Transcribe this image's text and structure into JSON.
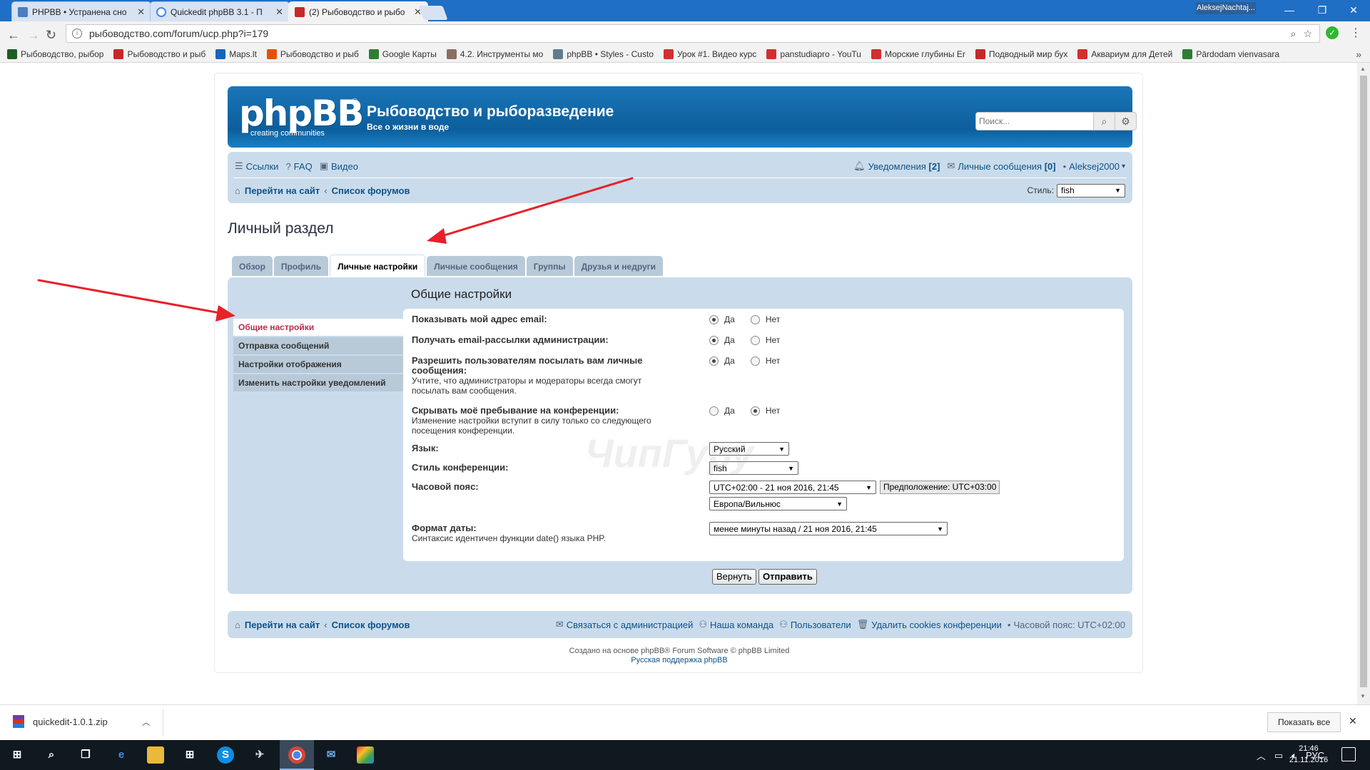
{
  "browser": {
    "tabs": [
      {
        "label": "PHPBB • Устранена сно",
        "favicon_color": "#4a7fc1"
      },
      {
        "label": "Quickedit phpBB 3.1 - П",
        "favicon_color": "#6a6a6a"
      },
      {
        "label": "(2) Рыбоводство и рыбо",
        "favicon_color": "#c62828"
      }
    ],
    "window_user": "AleksejNachtaj...",
    "url": "рыбоводство.com/forum/ucp.php?i=179",
    "bookmarks": [
      {
        "label": "Рыбоводство, рыбор",
        "color": "#1b5e20"
      },
      {
        "label": "Рыбоводство и рыб",
        "color": "#c62828"
      },
      {
        "label": "Maps.lt",
        "color": "#1565c0"
      },
      {
        "label": "Рыбоводство и рыб",
        "color": "#e65100"
      },
      {
        "label": "Google Карты",
        "color": "#2e7d32"
      },
      {
        "label": "4.2. Инструменты мо",
        "color": "#8d6e63"
      },
      {
        "label": "phpBB • Styles - Custo",
        "color": "#607d8b"
      },
      {
        "label": "Урок #1. Видео курс",
        "color": "#d32f2f"
      },
      {
        "label": "panstudiapro - YouTu",
        "color": "#d32f2f"
      },
      {
        "label": "Морские глубины Er",
        "color": "#d32f2f"
      },
      {
        "label": "Подводный мир бух",
        "color": "#c62828"
      },
      {
        "label": "Аквариум для Детей",
        "color": "#d32f2f"
      },
      {
        "label": "Pārdodam vienvasara",
        "color": "#2e7d32"
      }
    ]
  },
  "forum": {
    "logo_text": "phpBB",
    "logo_sub": "creating communities",
    "logo_reg": "®",
    "site_title": "Рыбоводство и рыборазведение",
    "site_desc": "Все о жизни в воде",
    "search_placeholder": "Поиск...",
    "nav": {
      "links": [
        "Ссылки",
        "FAQ",
        "Видео"
      ],
      "notifications_label": "Уведомления",
      "notifications_count": "[2]",
      "pm_label": "Личные сообщения",
      "pm_count": "[0]",
      "username": "Aleksej2000",
      "crumb_site": "Перейти на сайт",
      "crumb_sep": "‹",
      "crumb_index": "Список форумов",
      "style_label": "Стиль:",
      "style_value": "fish"
    },
    "page_title": "Личный раздел",
    "tabs": [
      "Обзор",
      "Профиль",
      "Личные настройки",
      "Личные сообщения",
      "Группы",
      "Друзья и недруги"
    ],
    "menu": [
      "Общие настройки",
      "Отправка сообщений",
      "Настройки отображения",
      "Изменить настройки уведомлений"
    ],
    "pane_title": "Общие настройки",
    "fields": {
      "show_email": {
        "label": "Показывать мой адрес email:",
        "selected": "yes"
      },
      "admin_mail": {
        "label": "Получать email-рассылки администрации:",
        "selected": "yes"
      },
      "allow_pm": {
        "label": "Разрешить пользователям посылать вам личные сообщения:",
        "desc": "Учтите, что администраторы и модераторы всегда смогут посылать вам сообщения.",
        "selected": "yes"
      },
      "hide_online": {
        "label": "Скрывать моё пребывание на конференции:",
        "desc": "Изменение настройки вступит в силу только со следующего посещения конференции.",
        "selected": "no"
      },
      "language": {
        "label": "Язык:",
        "value": "Русский"
      },
      "board_style": {
        "label": "Стиль конференции:",
        "value": "fish"
      },
      "timezone": {
        "label": "Часовой пояс:",
        "value": "UTC+02:00 - 21 ноя 2016, 21:45",
        "guess": "Предположение: UTC+03:00",
        "region": "Европа/Вильнюс"
      },
      "dateformat": {
        "label": "Формат даты:",
        "desc": "Синтаксис идентичен функции date() языка PHP.",
        "value": "менее минуты назад / 21 ноя 2016, 21:45"
      }
    },
    "yes": "Да",
    "no": "Нет",
    "reset_button": "Вернуть",
    "submit_button": "Отправить",
    "watermark": "ЧипГуру",
    "footer": {
      "crumb_site": "Перейти на сайт",
      "crumb_index": "Список форумов",
      "contact": "Связаться с администрацией",
      "team": "Наша команда",
      "members": "Пользователи",
      "delete_cookies": "Удалить cookies конференции",
      "timezone": "Часовой пояс: UTC+02:00",
      "powered": "Создано на основе phpBB® Forum Software © phpBB Limited",
      "support": "Русская поддержка phpBB"
    }
  },
  "download": {
    "file": "quickedit-1.0.1.zip",
    "show_all": "Показать все"
  },
  "taskbar": {
    "lang": "РУС",
    "time": "21:46",
    "date": "21.11.2016"
  },
  "colors": {
    "header_blue": "#0d5e9c",
    "nav_bg": "#cadceb",
    "tab_bg": "#b8cad8",
    "link": "#105289",
    "active_menu": "#bc2a4d",
    "annotation_arrow": "#e8202a"
  }
}
